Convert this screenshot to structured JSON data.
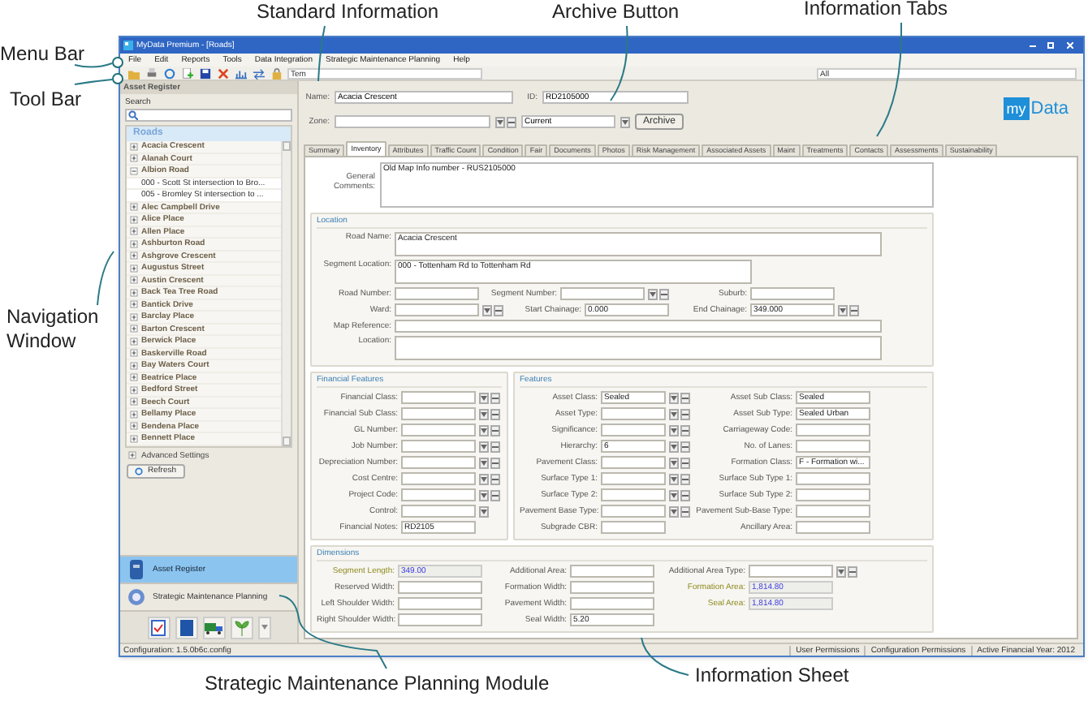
{
  "annotations": [
    {
      "kind": "menu_bar",
      "text": "Menu Bar"
    },
    {
      "kind": "tool_bar",
      "text": "Tool Bar"
    },
    {
      "kind": "navigation",
      "text": "Navigation Window"
    },
    {
      "kind": "standard_info",
      "text": "Standard Information"
    },
    {
      "kind": "archive",
      "text": "Archive Button"
    },
    {
      "kind": "info_tabs",
      "text": "Information Tabs"
    },
    {
      "kind": "smp_module",
      "text": "Strategic Maintenance Planning Module"
    },
    {
      "kind": "info_sheet",
      "text": "Information Sheet"
    }
  ],
  "window": {
    "title": "MyData Premium - [Roads]"
  },
  "menu": [
    "File",
    "Edit",
    "Reports",
    "Tools",
    "Data Integration",
    "Strategic Maintenance Planning",
    "Help"
  ],
  "toolbar": {
    "template": "Tem",
    "filter": "All"
  },
  "sidebar": {
    "title": "Asset Register",
    "search_label": "Search",
    "tree_title": "Roads",
    "items": [
      {
        "label": "Acacia Crescent",
        "expanded": false
      },
      {
        "label": "Alanah Court",
        "expanded": false
      },
      {
        "label": "Albion Road",
        "expanded": true,
        "children": [
          {
            "label": "000 - Scott St intersection to Bro..."
          },
          {
            "label": "005 - Bromley St intersection to ..."
          }
        ]
      },
      {
        "label": "Alec Campbell Drive",
        "expanded": false
      },
      {
        "label": "Alice Place",
        "expanded": false
      },
      {
        "label": "Allen Place",
        "expanded": false
      },
      {
        "label": "Ashburton Road",
        "expanded": false
      },
      {
        "label": "Ashgrove Crescent",
        "expanded": false
      },
      {
        "label": "Augustus Street",
        "expanded": false
      },
      {
        "label": "Austin Crescent",
        "expanded": false
      },
      {
        "label": "Back Tea Tree Road",
        "expanded": false
      },
      {
        "label": "Bantick Drive",
        "expanded": false
      },
      {
        "label": "Barclay Place",
        "expanded": false
      },
      {
        "label": "Barton Crescent",
        "expanded": false
      },
      {
        "label": "Berwick Place",
        "expanded": false
      },
      {
        "label": "Baskerville Road",
        "expanded": false
      },
      {
        "label": "Bay Waters Court",
        "expanded": false
      },
      {
        "label": "Beatrice Place",
        "expanded": false
      },
      {
        "label": "Bedford Street",
        "expanded": false
      },
      {
        "label": "Beech Court",
        "expanded": false
      },
      {
        "label": "Bellamy Place",
        "expanded": false
      },
      {
        "label": "Bendena Place",
        "expanded": false
      },
      {
        "label": "Bennett Place",
        "expanded": false
      }
    ],
    "advanced": "Advanced Settings",
    "refresh": "Refresh",
    "modules": [
      {
        "label": "Asset Register",
        "selected": true
      },
      {
        "label": "Strategic Maintenance Planning",
        "selected": false
      }
    ]
  },
  "header": {
    "name_label": "Name:",
    "name": "Acacia Crescent",
    "id_label": "ID:",
    "id": "RD2105000",
    "zone_label": "Zone:",
    "status": "Current",
    "archive": "Archive",
    "logo": [
      "my",
      "Data"
    ]
  },
  "tabs": [
    {
      "label": "Summary",
      "selected": false
    },
    {
      "label": "Inventory",
      "selected": true
    },
    {
      "label": "Attributes",
      "selected": false
    },
    {
      "label": "Traffic Count",
      "selected": false
    },
    {
      "label": "Condition",
      "selected": false
    },
    {
      "label": "Fair",
      "selected": false
    },
    {
      "label": "Documents",
      "selected": false
    },
    {
      "label": "Photos",
      "selected": false
    },
    {
      "label": "Risk Management",
      "selected": false
    },
    {
      "label": "Associated Assets",
      "selected": false
    },
    {
      "label": "Maint",
      "selected": false
    },
    {
      "label": "Treatments",
      "selected": false
    },
    {
      "label": "Contacts",
      "selected": false
    },
    {
      "label": "Assessments",
      "selected": false
    },
    {
      "label": "Sustainability",
      "selected": false
    }
  ],
  "sheet": {
    "comments": {
      "label": "General Comments:",
      "value": "Old Map Info number - RUS2105000"
    },
    "location": {
      "title": "Location",
      "rows": [
        [
          {
            "label": "Road Name:",
            "value": "Acacia Crescent",
            "kind": "area"
          }
        ],
        [
          {
            "label": "Segment Location:",
            "value": "000 - Tottenham Rd to Tottenham Rd",
            "kind": "area"
          }
        ],
        [
          {
            "label": "Road Number:",
            "kind": "text"
          },
          {
            "label": "Segment Number:",
            "kind": "combo"
          },
          {
            "label": "Suburb:",
            "kind": "text"
          }
        ],
        [
          {
            "label": "Ward:",
            "kind": "combo"
          },
          {
            "label": "Start Chainage:",
            "value": "0.000",
            "kind": "text"
          },
          {
            "label": "End Chainage:",
            "value": "349.000",
            "kind": "combo"
          }
        ],
        [
          {
            "label": "Map Reference:",
            "kind": "text"
          }
        ],
        [
          {
            "label": "Location:",
            "kind": "area"
          }
        ]
      ]
    },
    "financial": {
      "title": "Financial Features",
      "fields": [
        {
          "label": "Financial Class:",
          "kind": "combo"
        },
        {
          "label": "Financial Sub Class:",
          "kind": "combo"
        },
        {
          "label": "GL Number:",
          "kind": "combo"
        },
        {
          "label": "Job Number:",
          "kind": "combo"
        },
        {
          "label": "Depreciation Number:",
          "kind": "combo"
        },
        {
          "label": "Cost Centre:",
          "kind": "combo"
        },
        {
          "label": "Project Code:",
          "kind": "combo"
        },
        {
          "label": "Control:",
          "kind": "select"
        },
        {
          "label": "Financial Notes:",
          "value": "RD2105",
          "kind": "text"
        }
      ]
    },
    "features": {
      "title": "Features",
      "columns": [
        [
          {
            "label": "Asset Class:",
            "value": "Sealed",
            "kind": "combo"
          },
          {
            "label": "Asset Type:",
            "kind": "combo"
          },
          {
            "label": "Significance:",
            "kind": "combo"
          },
          {
            "label": "Hierarchy:",
            "value": "6",
            "kind": "combo"
          },
          {
            "label": "Pavement Class:",
            "kind": "combo"
          },
          {
            "label": "Surface Type 1:",
            "kind": "combo"
          },
          {
            "label": "Surface Type 2:",
            "kind": "combo"
          },
          {
            "label": "Pavement Base Type:",
            "kind": "combo"
          },
          {
            "label": "Subgrade CBR:",
            "kind": "text"
          }
        ],
        [
          {
            "label": "Asset Sub Class:",
            "value": "Sealed",
            "kind": "text"
          },
          {
            "label": "Asset Sub Type:",
            "value": "Sealed Urban",
            "kind": "text"
          },
          {
            "label": "Carriageway Code:",
            "kind": "text"
          },
          {
            "label": "No. of Lanes:",
            "kind": "text"
          },
          {
            "label": "Formation Class:",
            "value": "F - Formation wi...",
            "kind": "text"
          },
          {
            "label": "Surface Sub Type 1:",
            "kind": "text"
          },
          {
            "label": "Surface Sub Type 2:",
            "kind": "text"
          },
          {
            "label": "Pavement Sub-Base Type:",
            "kind": "text"
          },
          {
            "label": "Ancillary Area:",
            "kind": "text"
          }
        ]
      ]
    },
    "dimensions": {
      "title": "Dimensions",
      "columns": [
        [
          {
            "label": "Segment Length:",
            "value": "349.00",
            "kind": "computed"
          },
          {
            "label": "Reserved Width:",
            "kind": "text"
          },
          {
            "label": "Left Shoulder Width:",
            "kind": "text"
          },
          {
            "label": "Right Shoulder Width:",
            "kind": "text"
          }
        ],
        [
          {
            "label": "Additional Area:",
            "kind": "text"
          },
          {
            "label": "Formation Width:",
            "kind": "text"
          },
          {
            "label": "Pavement Width:",
            "kind": "text"
          },
          {
            "label": "Seal Width:",
            "value": "5.20",
            "kind": "text"
          }
        ],
        [
          {
            "label": "Additional Area Type:",
            "kind": "combo"
          },
          {
            "label": "Formation Area:",
            "value": "1,814.80",
            "kind": "computed"
          },
          {
            "label": "Seal Area:",
            "value": "1,814.80",
            "kind": "computed"
          }
        ]
      ]
    }
  },
  "status_bar": {
    "config": "Configuration: 1.5.0b6c.config",
    "items": [
      "User Permissions",
      "Configuration Permissions",
      "Active Financial Year: 2012"
    ]
  }
}
